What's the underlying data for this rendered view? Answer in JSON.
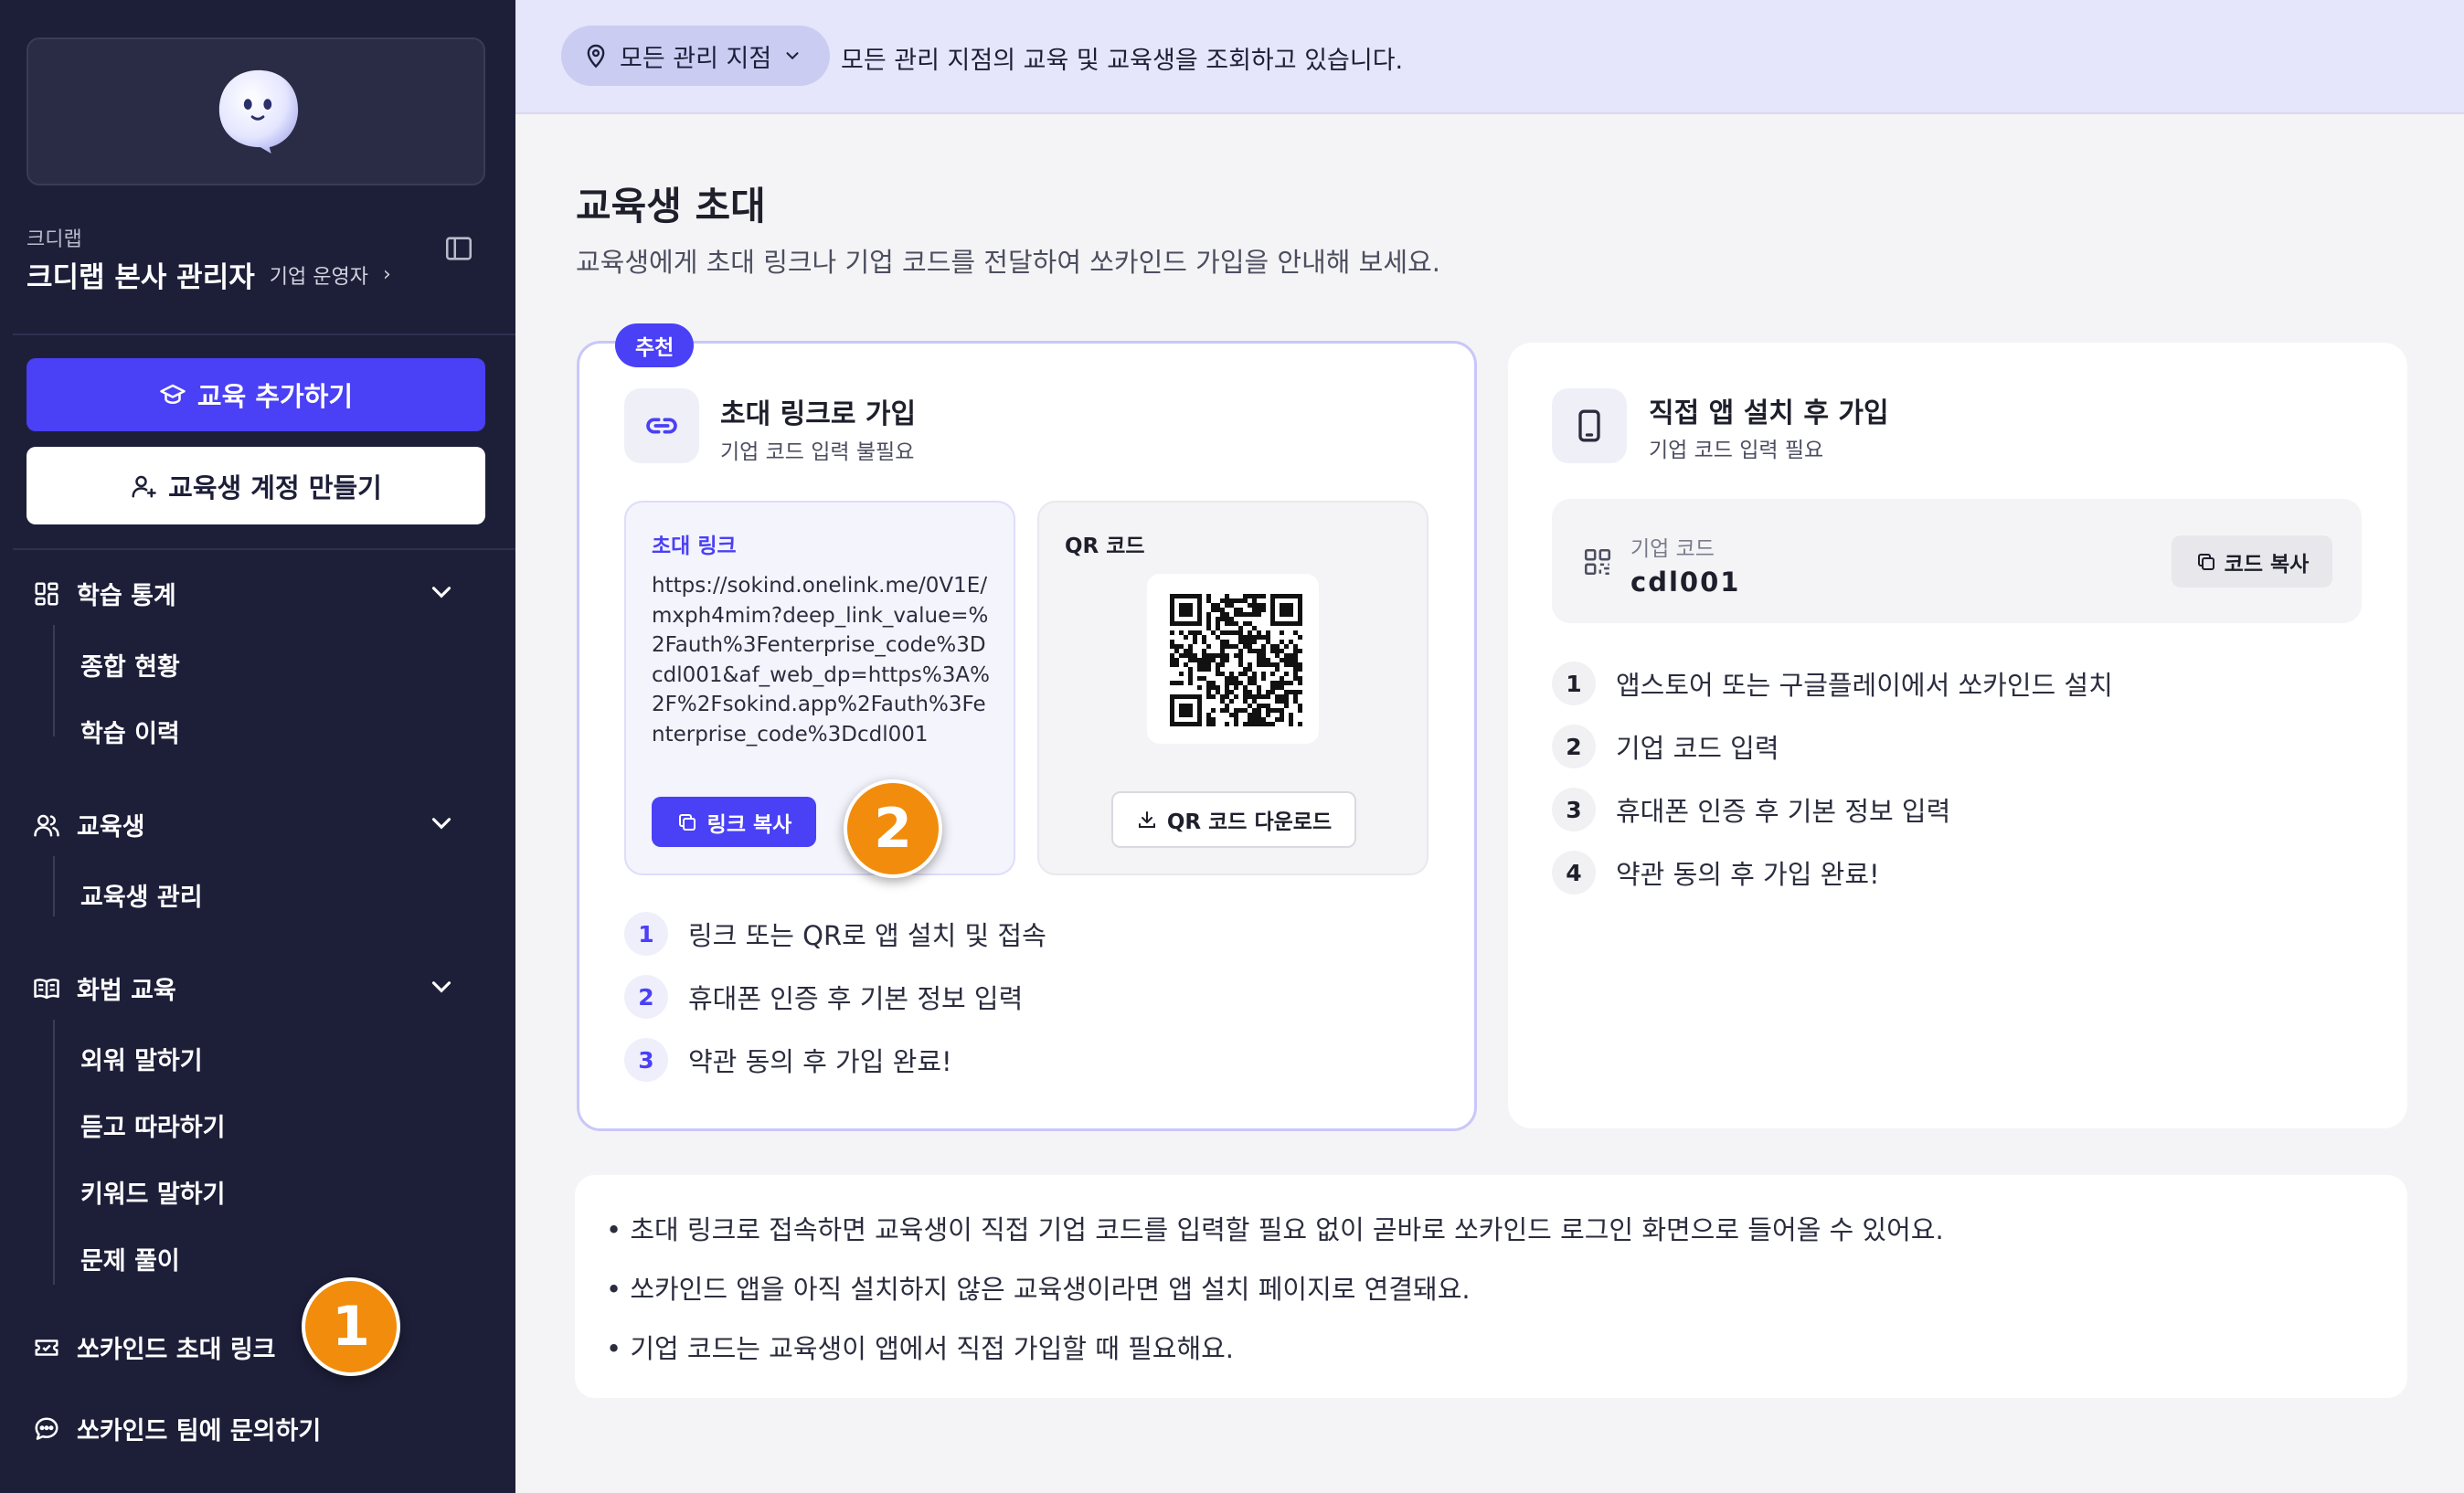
{
  "sidebar": {
    "org_small": "크디랩",
    "org_name": "크디랩 본사 관리자",
    "org_role": "기업 운영자",
    "org_chevron": "›",
    "add_education_label": "교육 추가하기",
    "create_account_label": "교육생 계정 만들기",
    "sections": [
      {
        "label": "학습 통계",
        "icon": "chart-grid-icon",
        "items": [
          "종합 현황",
          "학습 이력"
        ]
      },
      {
        "label": "교육생",
        "icon": "users-icon",
        "items": [
          "교육생 관리"
        ]
      },
      {
        "label": "화법 교육",
        "icon": "book-icon",
        "items": [
          "외워 말하기",
          "듣고 따라하기",
          "키워드 말하기",
          "문제 풀이"
        ]
      }
    ],
    "invite_link_label": "쏘카인드 초대 링크",
    "contact_label": "쏘카인드 팀에 문의하기"
  },
  "topbar": {
    "branch_selector": "모든 관리 지점",
    "message": "모든 관리 지점의 교육 및 교육생을 조회하고 있습니다."
  },
  "main": {
    "title": "교육생 초대",
    "subtitle": "교육생에게 초대 링크나 기업 코드를 전달하여 쏘카인드 가입을 안내해 보세요."
  },
  "invite_card": {
    "badge": "추천",
    "title": "초대 링크로 가입",
    "subtitle": "기업 코드 입력 불필요",
    "link_label": "초대 링크",
    "link_url": "https://sokind.onelink.me/0V1E/mxph4mim?deep_link_value=%2Fauth%3Fenterprise_code%3Dcdl001&af_web_dp=https%3A%2F%2Fsokind.app%2Fauth%3Fenterprise_code%3Dcdl001",
    "copy_link_label": "링크 복사",
    "qr_label": "QR 코드",
    "qr_download_label": "QR 코드 다운로드",
    "steps": [
      {
        "num": "1",
        "text": "링크 또는 QR로 앱 설치 및 접속"
      },
      {
        "num": "2",
        "text": "휴대폰 인증 후 기본 정보 입력"
      },
      {
        "num": "3",
        "text": "약관 동의 후 가입 완료!"
      }
    ]
  },
  "app_card": {
    "title": "직접 앱 설치 후 가입",
    "subtitle": "기업 코드 입력 필요",
    "code_label": "기업 코드",
    "code_value": "cdl001",
    "copy_code_label": "코드 복사",
    "steps": [
      {
        "num": "1",
        "text": "앱스토어 또는 구글플레이에서 쏘카인드 설치"
      },
      {
        "num": "2",
        "text": "기업 코드 입력"
      },
      {
        "num": "3",
        "text": "휴대폰 인증 후 기본 정보 입력"
      },
      {
        "num": "4",
        "text": "약관 동의 후 가입 완료!"
      }
    ]
  },
  "notes": [
    "• 초대 링크로 접속하면 교육생이 직접 기업 코드를 입력할 필요 없이 곧바로 쏘카인드 로그인 화면으로 들어올 수 있어요.",
    "• 쏘카인드 앱을 아직 설치하지 않은 교육생이라면 앱 설치 페이지로 연결돼요.",
    "• 기업 코드는 교육생이 앱에서 직접 가입할 때 필요해요."
  ],
  "markers": [
    "1",
    "2"
  ],
  "colors": {
    "accent": "#4A40F5",
    "sidebar_bg": "#1D1F39",
    "marker": "#F28C0C",
    "topbar_bg": "#E5E5FB"
  }
}
